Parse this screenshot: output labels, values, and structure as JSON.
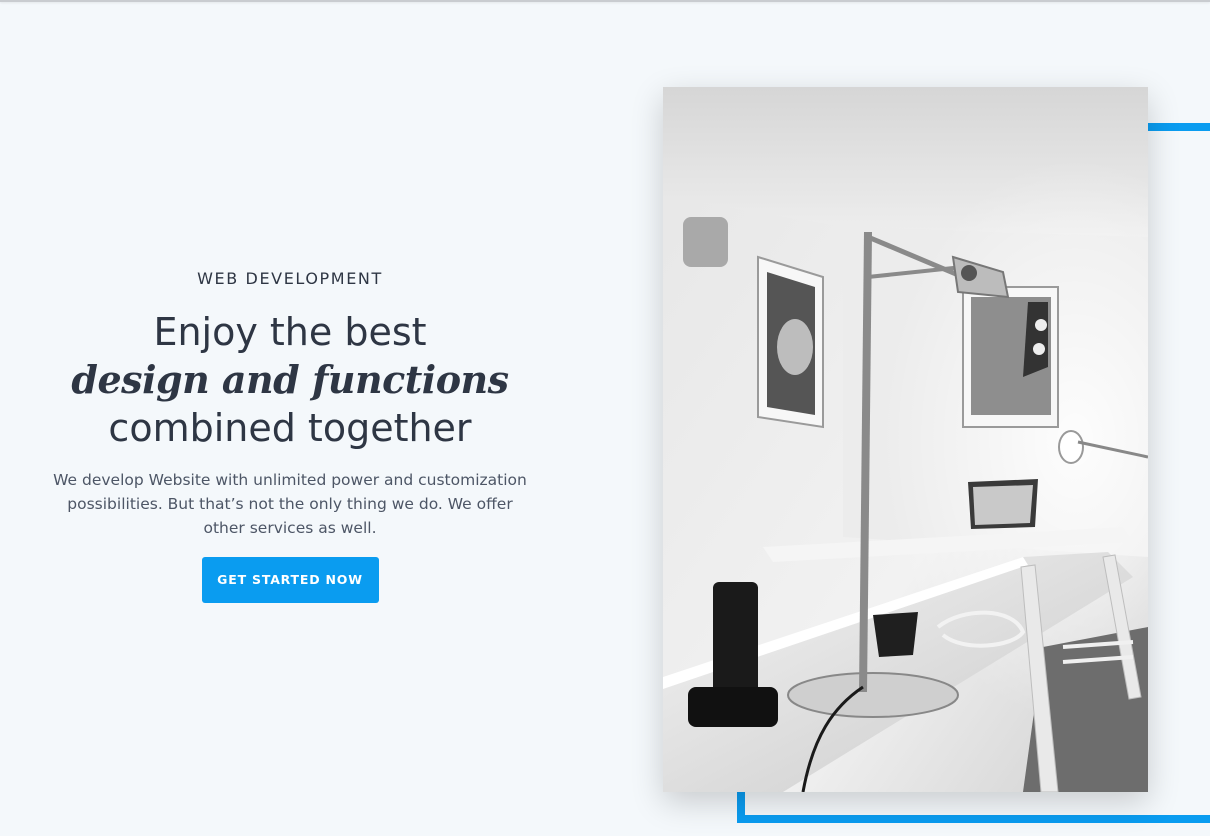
{
  "hero": {
    "eyebrow": "WEB DEVELOPMENT",
    "headline_line1": "Enjoy the best",
    "headline_line2": "design and functions",
    "headline_line3": "combined together",
    "description": "We develop Website with unlimited power and customization possibilities. But that’s not the only thing we do. We offer other services as well.",
    "cta_label": "GET STARTED NOW"
  },
  "colors": {
    "accent": "#0a9cf0",
    "background": "#f4f8fb",
    "text": "#2e3644"
  },
  "image": {
    "subject": "workspace-photo"
  }
}
